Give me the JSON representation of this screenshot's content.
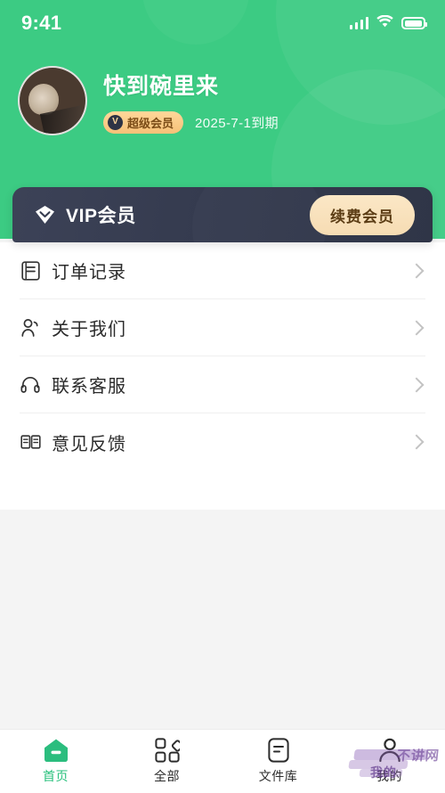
{
  "status_bar": {
    "time": "9:41",
    "signal_icon": "signal-bars-icon",
    "wifi_icon": "wifi-icon",
    "battery_icon": "battery-icon"
  },
  "profile": {
    "avatar_alt": "cat-avatar",
    "username": "快到碗里来",
    "vip_badge": {
      "mark": "V",
      "label": "超级会员"
    },
    "expiry": "2025-7-1到期"
  },
  "vip_card": {
    "icon": "diamond-icon",
    "title": "VIP会员",
    "renew_label": "续费会员"
  },
  "menu": {
    "items": [
      {
        "icon": "order-document-icon",
        "label": "订单记录"
      },
      {
        "icon": "person-icon",
        "label": "关于我们"
      },
      {
        "icon": "headset-icon",
        "label": "联系客服"
      },
      {
        "icon": "open-book-icon",
        "label": "意见反馈"
      }
    ]
  },
  "tabbar": {
    "items": [
      {
        "icon": "home-icon",
        "label": "首页",
        "active": true
      },
      {
        "icon": "grid-icon",
        "label": "全部",
        "active": false
      },
      {
        "icon": "file-library-icon",
        "label": "文件库",
        "active": false
      },
      {
        "icon": "user-icon",
        "label": "我的",
        "active": false
      }
    ]
  },
  "watermark": {
    "line1": "不讲网",
    "line2": "我的"
  },
  "colors": {
    "header_green": "#3ccb83",
    "accent_green": "#28c07c",
    "vip_card_dark": "#353b4f",
    "renew_cream": "#f6dcb3",
    "badge_gold": "#f7c178",
    "page_bg": "#f4f4f4"
  }
}
